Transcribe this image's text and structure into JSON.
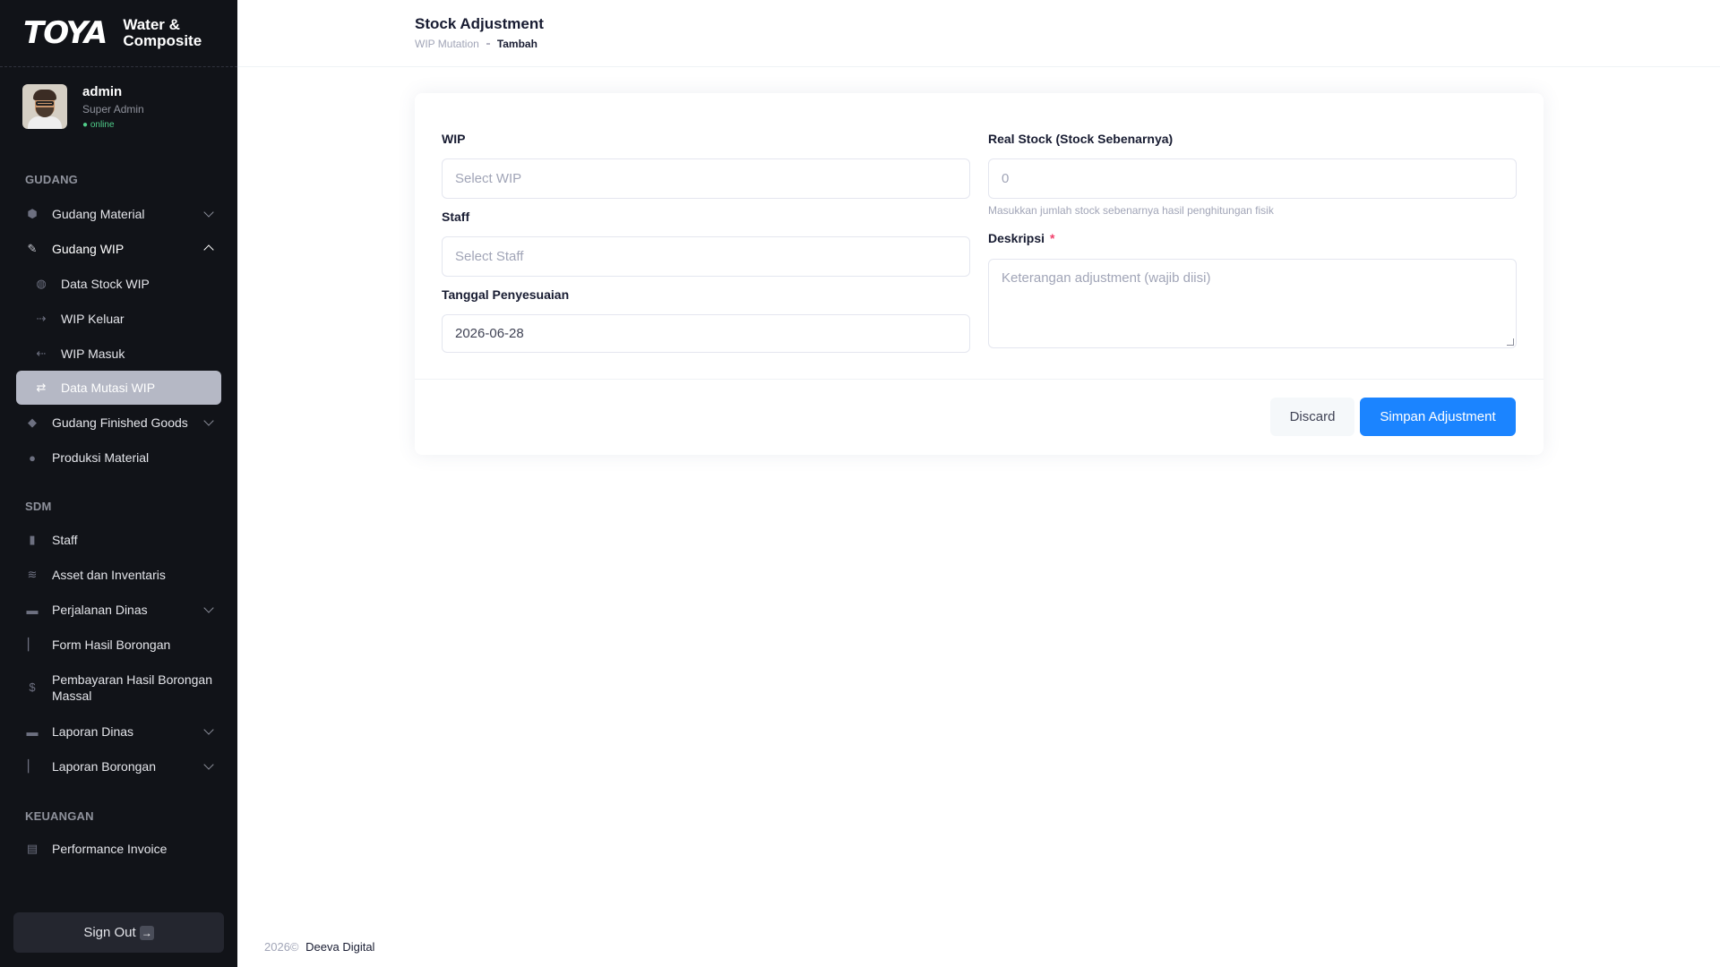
{
  "brand": {
    "logo": "TOYA",
    "line1": "Water &",
    "line2": "Composite"
  },
  "user": {
    "name": "admin",
    "role": "Super Admin",
    "status": "● online"
  },
  "sidebar": {
    "sections": [
      "GUDANG",
      "SDM",
      "KEUANGAN"
    ],
    "items": [
      {
        "label": "Gudang Material",
        "icon": "warehouse-icon"
      },
      {
        "label": "Gudang WIP",
        "icon": "wrench-icon"
      },
      {
        "label": "Data Stock WIP",
        "icon": "recycle-icon"
      },
      {
        "label": "WIP Keluar",
        "icon": "export-icon"
      },
      {
        "label": "WIP Masuk",
        "icon": "import-icon"
      },
      {
        "label": "Data Mutasi WIP",
        "icon": "arrows-icon"
      },
      {
        "label": "Gudang Finished Goods",
        "icon": "box-icon"
      },
      {
        "label": "Produksi Material",
        "icon": "disc-icon"
      },
      {
        "label": "Staff",
        "icon": "person-icon"
      },
      {
        "label": "Asset dan Inventaris",
        "icon": "layers-icon"
      },
      {
        "label": "Perjalanan Dinas",
        "icon": "briefcase-icon"
      },
      {
        "label": "Form Hasil Borongan",
        "icon": "bar-chart-icon"
      },
      {
        "label": "Pembayaran Hasil Borongan",
        "label2": "Massal",
        "icon": "dollar-icon"
      },
      {
        "label": "Laporan Dinas",
        "icon": "briefcase-icon"
      },
      {
        "label": "Laporan Borongan",
        "icon": "bar-chart-icon"
      },
      {
        "label": "Performance Invoice",
        "icon": "document-icon"
      }
    ],
    "signout": "Sign Out"
  },
  "header": {
    "title": "Stock Adjustment",
    "breadcrumb": [
      "WIP Mutation",
      "Tambah"
    ]
  },
  "form": {
    "wip": {
      "label": "WIP",
      "placeholder": "Select WIP"
    },
    "staff": {
      "label": "Staff",
      "placeholder": "Select Staff"
    },
    "date": {
      "label": "Tanggal Penyesuaian",
      "value": "2026-06-28"
    },
    "real_stock": {
      "label": "Real Stock (Stock Sebenarnya)",
      "placeholder": "0",
      "hint": "Masukkan jumlah stock sebenarnya hasil penghitungan fisik"
    },
    "description": {
      "label": "Deskripsi",
      "required": "*",
      "placeholder": "Keterangan adjustment (wajib diisi)"
    },
    "discard_label": "Discard",
    "save_label": "Simpan Adjustment"
  },
  "footer": {
    "year": "2026©",
    "company": "Deeva Digital"
  },
  "colors": {
    "primary": "#1b84ff",
    "sidebar_bg": "#111318",
    "active_item": "#b5b8c5",
    "required": "#f1416c",
    "online": "#50cd89"
  }
}
